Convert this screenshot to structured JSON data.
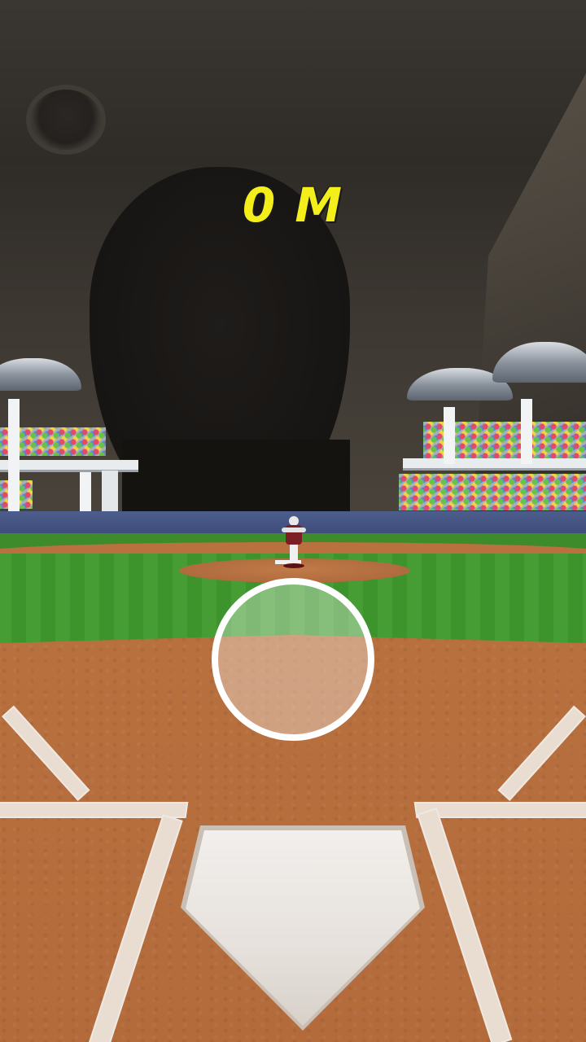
{
  "hud": {
    "distance": "0 M"
  },
  "scene": {
    "aim_label": "aim-circle"
  },
  "colors": {
    "distance_text": "#f4ef1a",
    "aim_ring": "#ffffff",
    "grass": "#3f9a2e",
    "dirt": "#b06a3c",
    "outfield_wall": "#4d5d8c",
    "pitcher_uniform": "#7b1f24"
  },
  "icons": {
    "aim": "circle-target-icon"
  }
}
